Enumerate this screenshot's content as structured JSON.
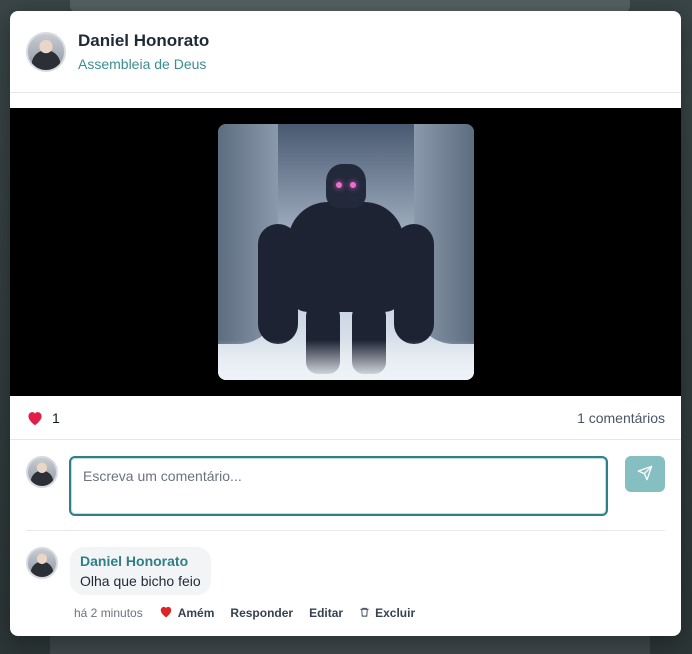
{
  "post": {
    "author": "Daniel Honorato",
    "church": "Assembleia de Deus",
    "likes_count": "1",
    "comments_count_label": "1 comentários"
  },
  "composer": {
    "placeholder": "Escreva um comentário..."
  },
  "comments": [
    {
      "author": "Daniel Honorato",
      "text": "Olha que bicho feio",
      "time": "há 2 minutos",
      "amen_label": "Amém",
      "reply_label": "Responder",
      "edit_label": "Editar",
      "delete_label": "Excluir"
    }
  ],
  "colors": {
    "accent": "#2f7f86",
    "church_text": "#3a8f8f",
    "like_heart": "#dc2626",
    "send_button": "#86bfc2"
  },
  "icons": {
    "like": "heart-icon",
    "send": "send-icon",
    "delete": "trash-icon"
  }
}
